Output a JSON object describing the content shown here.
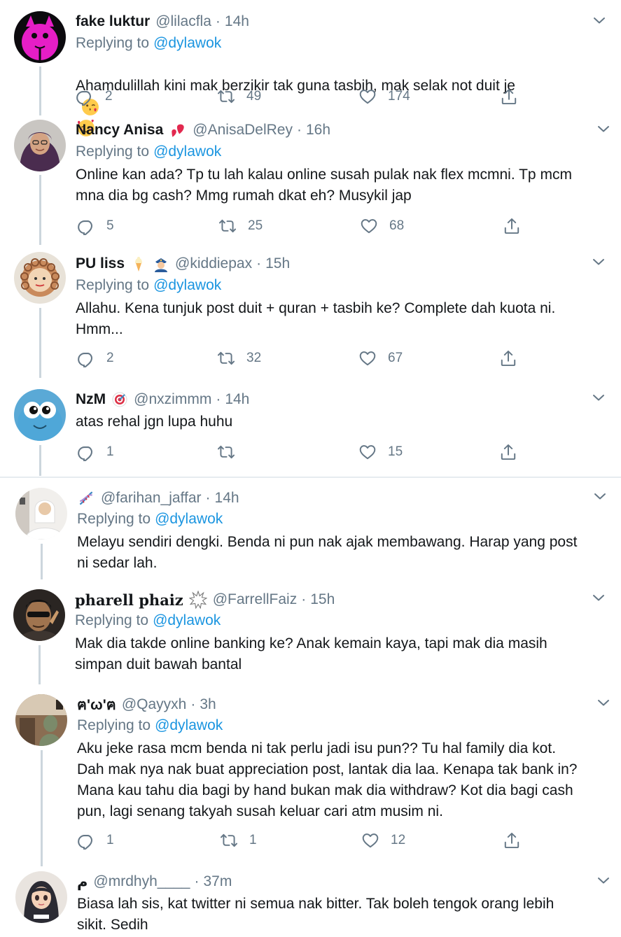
{
  "replying_label": "Replying to",
  "tweets": [
    {
      "name": "fake luktur",
      "handle": "@lilacfla",
      "time": "14h",
      "mention": "@dylawok",
      "text": "Ahamdulillah kini mak berzikir tak guna tasbih, mak selak not duit je",
      "replies": "2",
      "retweets": "49",
      "likes": "174"
    },
    {
      "name": "Nancy Anisa",
      "handle": "@AnisaDelRey",
      "time": "16h",
      "mention": "@dylawok",
      "text": "Online kan ada? Tp tu lah kalau online susah pulak nak flex mcmni. Tp mcm\nmna dia bg cash? Mmg rumah dkat eh? Musykil jap",
      "replies": "5",
      "retweets": "25",
      "likes": "68"
    },
    {
      "name": "PU liss",
      "handle": "@kiddiepax",
      "time": "15h",
      "mention": "@dylawok",
      "text": "Allahu. Kena tunjuk post duit + quran + tasbih ke? Complete dah kuota ni.\nHmm...",
      "replies": "2",
      "retweets": "32",
      "likes": "67"
    },
    {
      "name": "NzM",
      "handle": "@nxzimmm",
      "time": "14h",
      "text": "atas rehal jgn lupa huhu",
      "replies": "1",
      "retweets": "",
      "likes": "15"
    },
    {
      "name": "",
      "handle": "@farihan_jaffar",
      "time": "14h",
      "mention": "@dylawok",
      "text": "Melayu sendiri dengki. Benda ni pun nak ajak membawang. Harap yang post\nni sedar lah."
    },
    {
      "name": "pharell phaiz",
      "handle": "@FarrellFaiz",
      "time": "15h",
      "mention": "@dylawok",
      "text": "Mak dia takde online banking ke? Anak kemain kaya, tapi mak dia masih\nsimpan duit bawah bantal"
    },
    {
      "name": "ฅ'ω'ฅ",
      "handle": "@Qayyxh",
      "time": "3h",
      "mention": "@dylawok",
      "text": "Aku jeke rasa mcm benda ni tak perlu jadi isu pun?? Tu hal family dia kot.\nDah mak nya nak buat appreciation post, lantak dia laa. Kenapa tak bank in?\nMana kau tahu dia bagi by hand bukan mak dia withdraw? Kot dia bagi cash\npun, lagi senang takyah susah keluar cari atm musim ni.",
      "replies": "1",
      "retweets": "1",
      "likes": "12"
    },
    {
      "name": "م",
      "handle": "@mrdhyh____",
      "time": "37m",
      "text": "Biasa lah sis, kat twitter ni semua nak bitter. Tak boleh tengok orang lebih\nsikit. Sedih"
    }
  ],
  "colors": {
    "text": "#14171a",
    "muted": "#657786",
    "link": "#1b95e0",
    "thread_line": "#ccd6dd"
  }
}
